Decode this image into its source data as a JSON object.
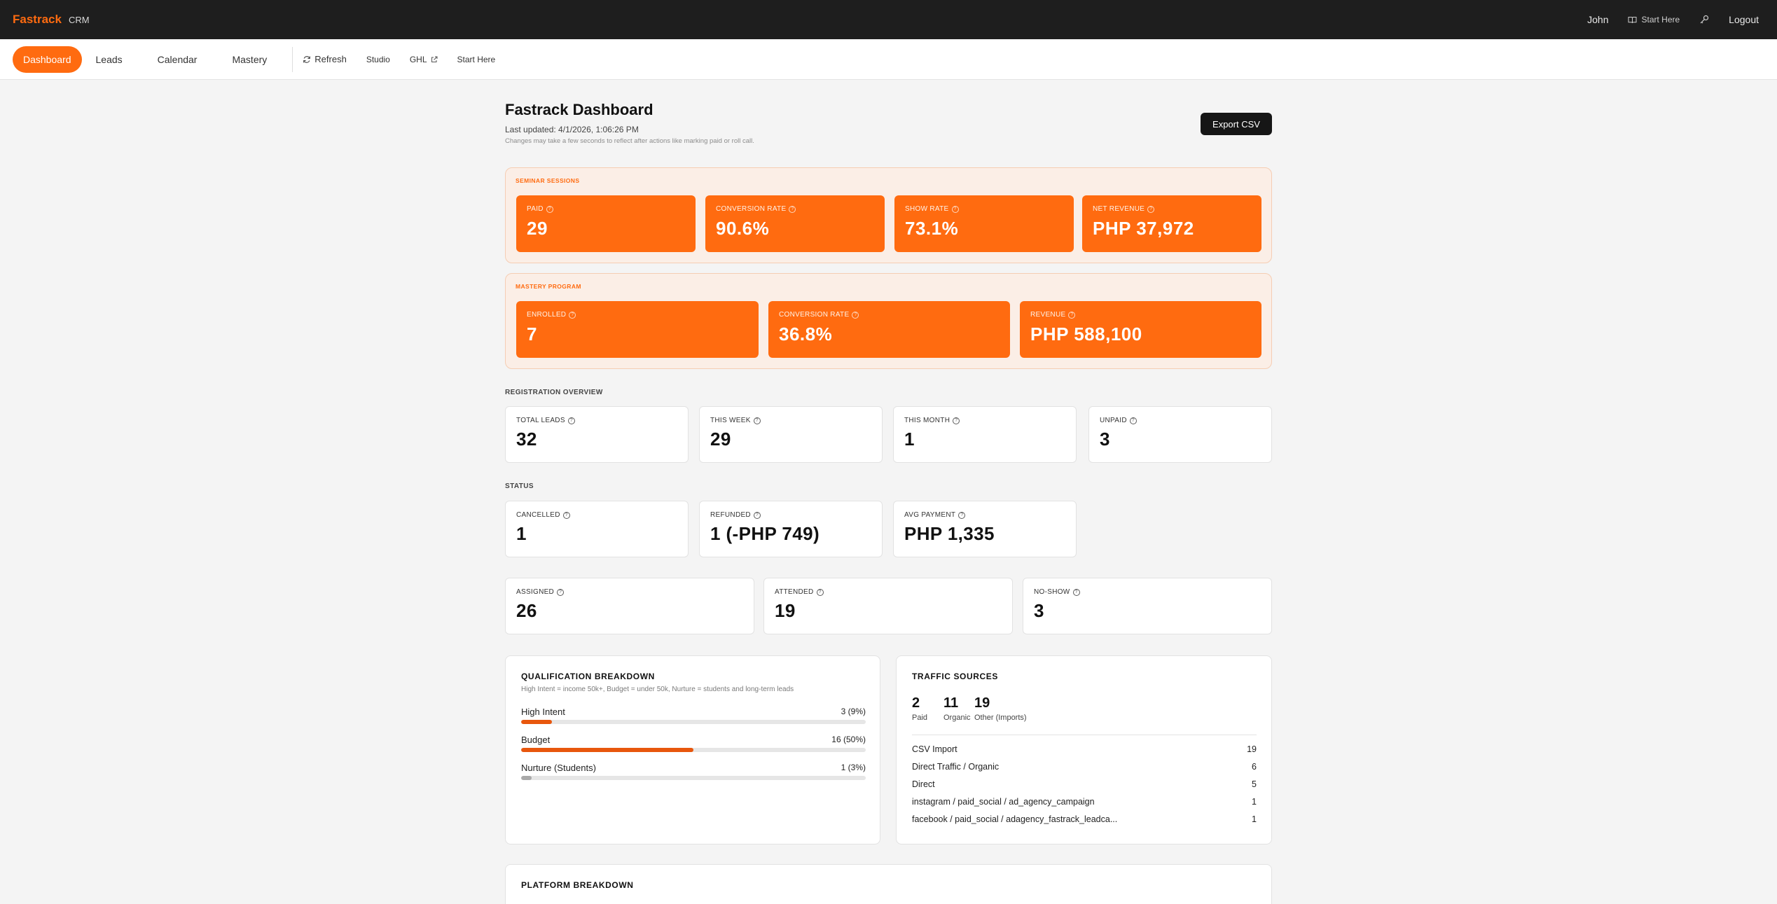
{
  "topbar": {
    "brand": "Fastrack",
    "brand_sub": "CRM",
    "user": "John",
    "start_here": "Start Here",
    "logout": "Logout"
  },
  "nav": {
    "items": [
      "Dashboard",
      "Leads",
      "Calendar",
      "Mastery"
    ],
    "active": "Dashboard",
    "refresh": "Refresh",
    "studio": "Studio",
    "ghl": "GHL",
    "start_here": "Start Here"
  },
  "header": {
    "title": "Fastrack Dashboard",
    "last_updated": "Last updated: 4/1/2026, 1:06:26 PM",
    "note": "Changes may take a few seconds to reflect after actions like marking paid or roll call.",
    "export_label": "Export CSV"
  },
  "seminar": {
    "label": "SEMINAR SESSIONS",
    "cards": [
      {
        "label": "PAID",
        "value": "29"
      },
      {
        "label": "CONVERSION RATE",
        "value": "90.6%"
      },
      {
        "label": "SHOW RATE",
        "value": "73.1%"
      },
      {
        "label": "NET REVENUE",
        "value": "PHP 37,972"
      }
    ]
  },
  "mastery": {
    "label": "MASTERY PROGRAM",
    "cards": [
      {
        "label": "ENROLLED",
        "value": "7"
      },
      {
        "label": "CONVERSION RATE",
        "value": "36.8%"
      },
      {
        "label": "REVENUE",
        "value": "PHP 588,100"
      }
    ]
  },
  "registration": {
    "label": "REGISTRATION OVERVIEW",
    "cards": [
      {
        "label": "TOTAL LEADS",
        "value": "32"
      },
      {
        "label": "THIS WEEK",
        "value": "29"
      },
      {
        "label": "THIS MONTH",
        "value": "1"
      },
      {
        "label": "UNPAID",
        "value": "3"
      }
    ]
  },
  "status": {
    "label": "STATUS",
    "cards": [
      {
        "label": "CANCELLED",
        "value": "1"
      },
      {
        "label": "REFUNDED",
        "value": "1 (-PHP 749)"
      },
      {
        "label": "AVG PAYMENT",
        "value": "PHP 1,335"
      }
    ],
    "attendance": [
      {
        "label": "ASSIGNED",
        "value": "26"
      },
      {
        "label": "ATTENDED",
        "value": "19"
      },
      {
        "label": "NO-SHOW",
        "value": "3"
      }
    ]
  },
  "qualification": {
    "title": "QUALIFICATION BREAKDOWN",
    "subtitle": "High Intent = income 50k+, Budget = under 50k, Nurture = students and long-term leads",
    "rows": [
      {
        "name": "High Intent",
        "count": "3 (9%)",
        "fraction": 0.09
      },
      {
        "name": "Budget",
        "count": "16 (50%)",
        "fraction": 0.5
      },
      {
        "name": "Nurture (Students)",
        "count": "1 (3%)",
        "fraction": 0.03
      }
    ]
  },
  "traffic": {
    "title": "TRAFFIC SOURCES",
    "stats": [
      {
        "value": "2",
        "label": "Paid"
      },
      {
        "value": "11",
        "label": "Organic"
      },
      {
        "value": "19",
        "label": "Other (Imports)"
      }
    ],
    "rows": [
      {
        "label": "CSV Import",
        "value": "19"
      },
      {
        "label": "Direct Traffic / Organic",
        "value": "6"
      },
      {
        "label": "Direct",
        "value": "5"
      },
      {
        "label": "instagram / paid_social / ad_agency_campaign",
        "value": "1"
      },
      {
        "label": "facebook / paid_social / adagency_fastrack_leadca...",
        "value": "1"
      }
    ]
  },
  "platform": {
    "title": "PLATFORM BREAKDOWN"
  },
  "colors": {
    "accent": "#ff6b10",
    "topbar": "#1e1e1e",
    "background": "#f4f4f4"
  }
}
